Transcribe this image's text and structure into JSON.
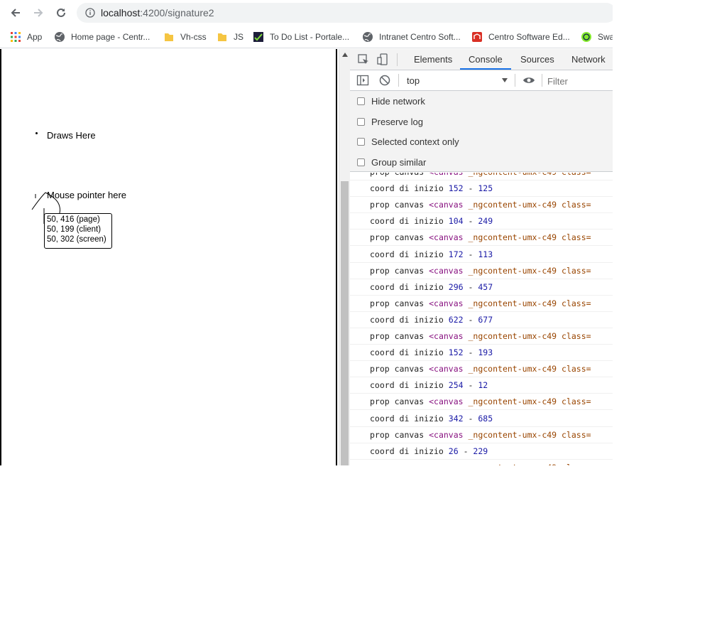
{
  "browser": {
    "url_host": "localhost",
    "url_path": ":4200/signature2"
  },
  "bookmarks": [
    {
      "label": "App",
      "icon": "apps-grid-icon"
    },
    {
      "label": "Home page - Centr...",
      "icon": "globe-icon"
    },
    {
      "label": "Vh-css",
      "icon": "folder-icon"
    },
    {
      "label": "JS",
      "icon": "folder-icon"
    },
    {
      "label": "To Do List - Portale...",
      "icon": "todo-icon"
    },
    {
      "label": "Intranet Centro Soft...",
      "icon": "globe-icon"
    },
    {
      "label": "Centro Software Ed...",
      "icon": "centro-logo-icon"
    },
    {
      "label": "Swa",
      "icon": "swagger-icon"
    }
  ],
  "page": {
    "draws_label": "Draws Here",
    "pointer_label": "Mouse pointer here",
    "coords": {
      "page": "50, 416 (page)",
      "client": "50, 199 (client)",
      "screen": "50, 302 (screen)"
    }
  },
  "devtools": {
    "tabs": [
      "Elements",
      "Console",
      "Sources",
      "Network"
    ],
    "active_tab": "Console",
    "context": "top",
    "filter_placeholder": "Filter",
    "options": [
      "Hide network",
      "Preserve log",
      "Selected context only",
      "Group similar"
    ],
    "log_prop_label": "prop canvas",
    "log_canvas_tag": "<canvas",
    "log_canvas_attrs": "_ngcontent-umx-c49 class=",
    "log_coord_label": "coord di inizio",
    "log_coord_sep": "-",
    "coords": [
      [
        "152",
        "125"
      ],
      [
        "104",
        "249"
      ],
      [
        "172",
        "113"
      ],
      [
        "296",
        "457"
      ],
      [
        "622",
        "677"
      ],
      [
        "152",
        "193"
      ],
      [
        "254",
        "12"
      ],
      [
        "342",
        "685"
      ],
      [
        "26",
        "229"
      ]
    ]
  },
  "colors": {
    "active_tab_underline": "#1a73e8",
    "tag": "#881280",
    "attr": "#994500",
    "number": "#1a1aa6"
  }
}
